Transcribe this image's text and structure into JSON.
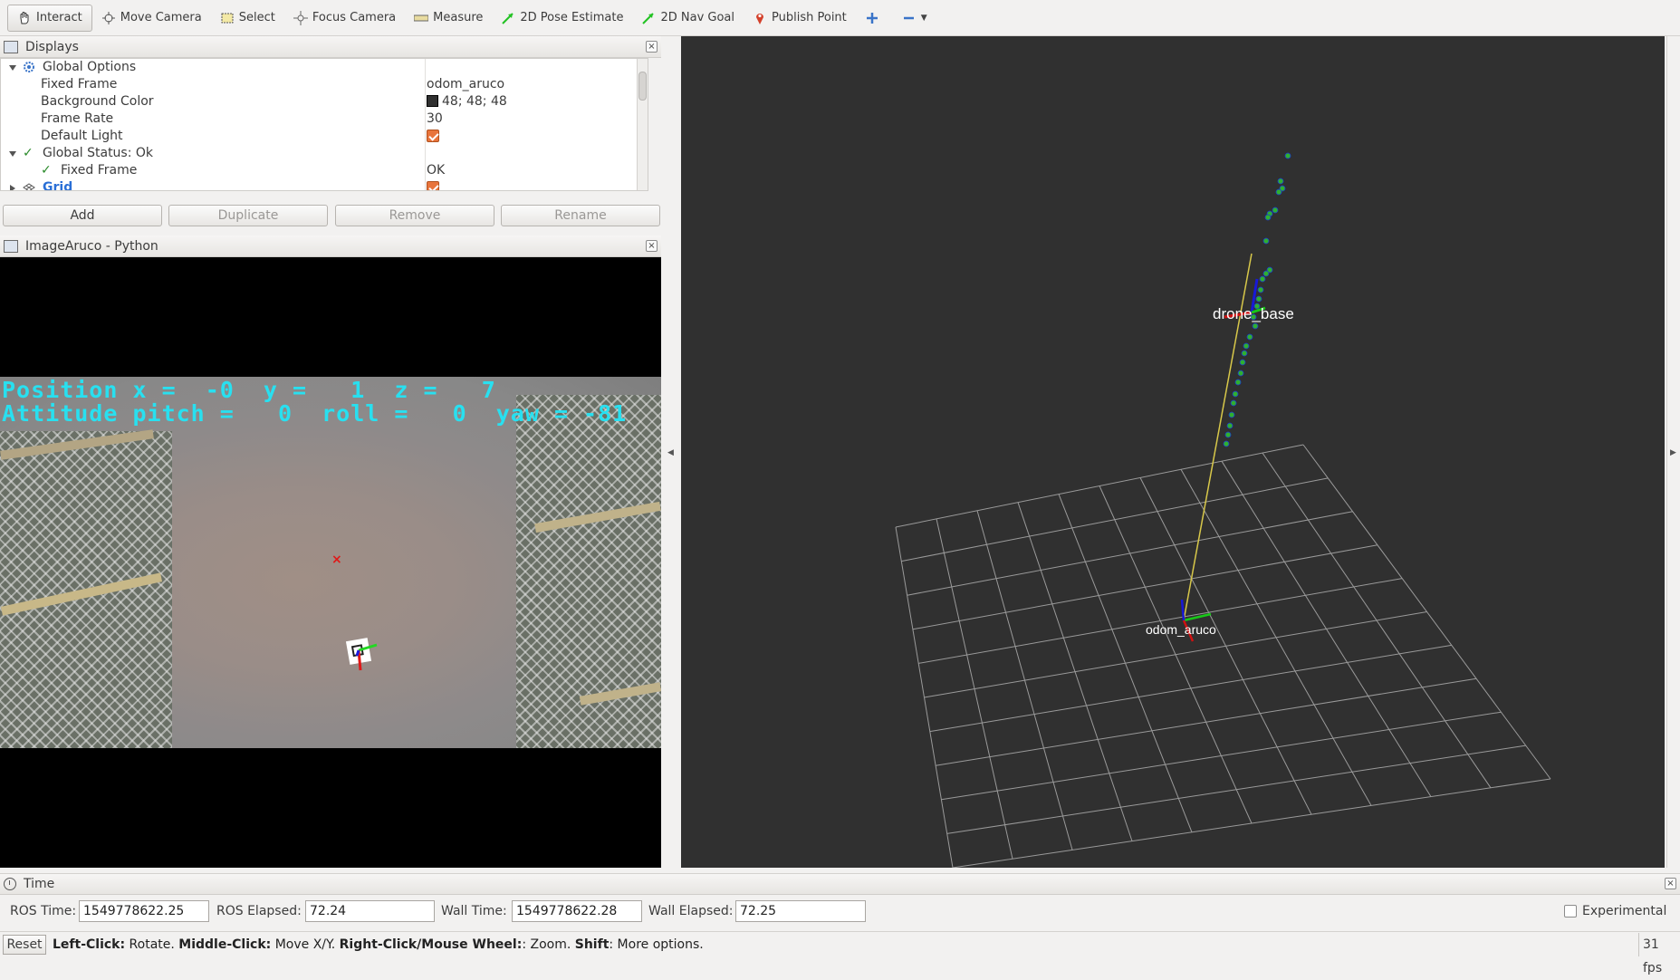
{
  "toolbar": {
    "tools": [
      {
        "label": "Interact",
        "icon": "hand-icon"
      },
      {
        "label": "Move Camera",
        "icon": "move-camera-icon"
      },
      {
        "label": "Select",
        "icon": "select-icon"
      },
      {
        "label": "Focus Camera",
        "icon": "focus-icon"
      },
      {
        "label": "Measure",
        "icon": "ruler-icon"
      },
      {
        "label": "2D Pose Estimate",
        "icon": "pose-arrow-icon"
      },
      {
        "label": "2D Nav Goal",
        "icon": "nav-arrow-icon"
      },
      {
        "label": "Publish Point",
        "icon": "pin-icon"
      }
    ]
  },
  "displays": {
    "title": "Displays",
    "rows": [
      {
        "label": "Global Options",
        "value": ""
      },
      {
        "label": "Fixed Frame",
        "value": "odom_aruco"
      },
      {
        "label": "Background Color",
        "value": "48; 48; 48"
      },
      {
        "label": "Frame Rate",
        "value": "30"
      },
      {
        "label": "Default Light",
        "value": ""
      },
      {
        "label": "Global Status: Ok",
        "value": ""
      },
      {
        "label": "Fixed Frame",
        "value": "OK"
      },
      {
        "label": "Grid",
        "value": ""
      }
    ],
    "buttons": {
      "add": "Add",
      "duplicate": "Duplicate",
      "remove": "Remove",
      "rename": "Rename"
    }
  },
  "image_panel": {
    "title": "ImageAruco - Python",
    "position_line": "Position x =  -0  y =   1  z =   7",
    "attitude_line": "Attitude pitch =   0  roll =   0  yaw = -81"
  },
  "view3d": {
    "frame_drone": "drone_base",
    "frame_odom": "odom_aruco"
  },
  "time": {
    "title": "Time",
    "ros_time_label": "ROS Time:",
    "ros_time": "1549778622.25",
    "ros_elapsed_label": "ROS Elapsed:",
    "ros_elapsed": "72.24",
    "wall_time_label": "Wall Time:",
    "wall_time": "1549778622.28",
    "wall_elapsed_label": "Wall Elapsed:",
    "wall_elapsed": "72.25",
    "experimental_label": "Experimental"
  },
  "status": {
    "reset": "Reset",
    "hint_left_key": "Left-Click:",
    "hint_left": " Rotate. ",
    "hint_middle_key": "Middle-Click:",
    "hint_middle": " Move X/Y. ",
    "hint_right_key": "Right-Click/Mouse Wheel:",
    "hint_right": ": Zoom. ",
    "hint_shift_key": "Shift",
    "hint_shift": ": More options.",
    "fps": "31 fps"
  },
  "colors": {
    "accent_link": "#2a6fd6",
    "overlay_cyan": "#28e0f0",
    "view_bg": "#303030"
  }
}
